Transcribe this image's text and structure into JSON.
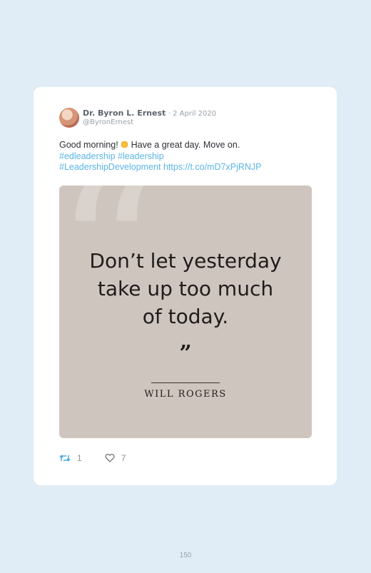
{
  "tweet": {
    "author_name": "Dr. Byron L. Ernest",
    "date": "· 2 April 2020",
    "handle": "@ByronErnest",
    "text_prefix": "Good morning!",
    "text_suffix": "Have a great day. Move on.",
    "hashtag_1": "#edleadership",
    "hashtag_2": "#leadership",
    "hashtag_3": "#LeadershipDevelopment",
    "link": "https://t.co/mD7xPjRNJP",
    "emoji": "sun-emoji"
  },
  "quote_image": {
    "line_1": "Don’t let yesterday",
    "line_2": "take up too much",
    "line_3": "of today.",
    "close_mark": "”",
    "author": "WILL ROGERS"
  },
  "actions": {
    "retweet_icon": "retweet-icon",
    "retweet_count": "1",
    "like_icon": "heart-icon",
    "like_count": "7"
  },
  "page": {
    "number": "150"
  },
  "colors": {
    "background": "#e1edf6",
    "link": "#5bb5e6",
    "quote_bg": "#cfc5bf"
  }
}
